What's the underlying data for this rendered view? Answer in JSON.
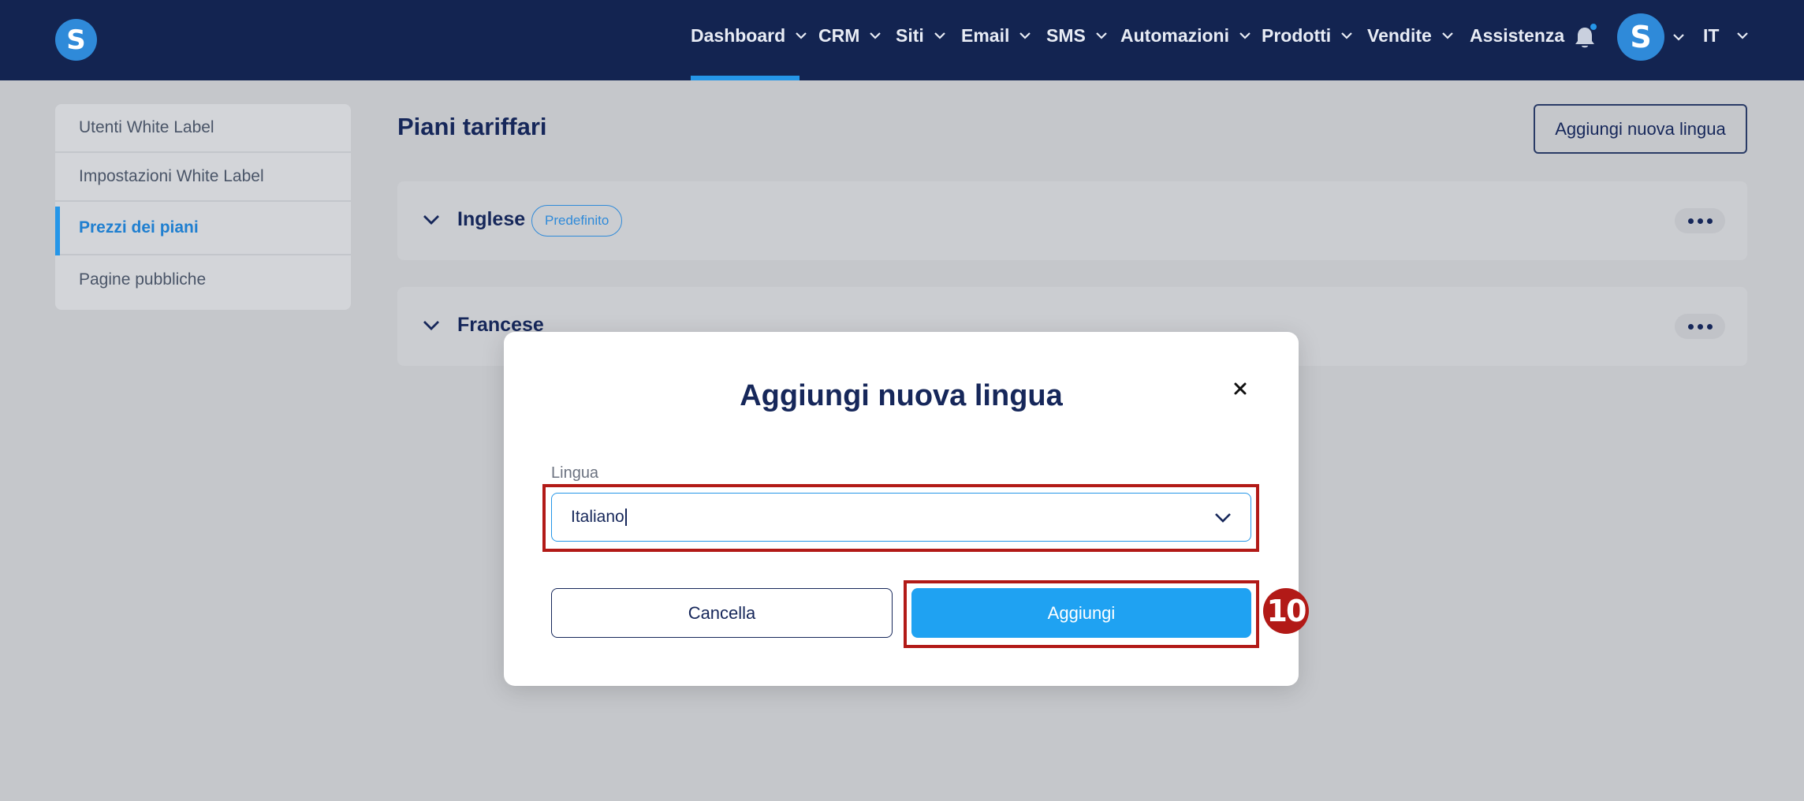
{
  "app": {
    "logo_letter": "S"
  },
  "nav": {
    "items": [
      {
        "label": "Dashboard"
      },
      {
        "label": "CRM"
      },
      {
        "label": "Siti"
      },
      {
        "label": "Email"
      },
      {
        "label": "SMS"
      },
      {
        "label": "Automazioni"
      },
      {
        "label": "Prodotti"
      },
      {
        "label": "Vendite"
      },
      {
        "label": "Assistenza"
      }
    ],
    "active": "Dashboard",
    "avatar_letter": "S",
    "language": "IT",
    "icons": [
      "bell-icon",
      "chevron-down-icon"
    ],
    "notification_dot_color": "#2596e8"
  },
  "sidebar": {
    "items": [
      {
        "label": "Utenti White Label"
      },
      {
        "label": "Impostazioni White Label"
      },
      {
        "label": "Prezzi dei piani"
      },
      {
        "label": "Pagine pubbliche"
      }
    ],
    "active": "Prezzi dei piani"
  },
  "main": {
    "title": "Piani tariffari",
    "add_language_label": "Aggiungi nuova lingua",
    "languages": [
      {
        "name": "Inglese",
        "badge": "Predefinito"
      },
      {
        "name": "Francese"
      }
    ]
  },
  "modal": {
    "title": "Aggiungi nuova lingua",
    "field_label": "Lingua",
    "field_value": "Italiano",
    "cancel_label": "Cancella",
    "add_label": "Aggiungi"
  },
  "annotation": {
    "step_number": "10",
    "color": "#b21a17"
  },
  "colors": {
    "navbar": "#132451",
    "accent": "#2596e8",
    "primary_button": "#1fa2f2"
  }
}
